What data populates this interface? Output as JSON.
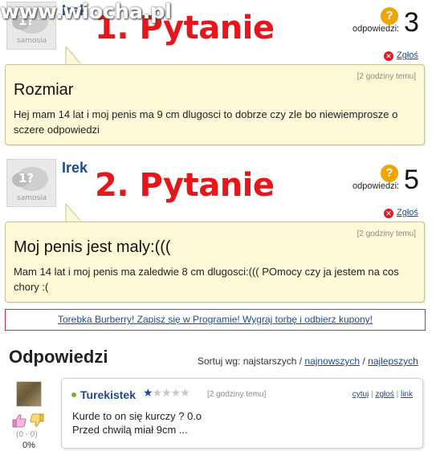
{
  "watermark": "www.wiocha.pl",
  "questions": [
    {
      "username": "Irek",
      "big_label": "1. Pytanie",
      "avatar_brand": "samosia",
      "answers_label": "odpowiedzi:",
      "answers_count": "3",
      "report_label": "Zgłoś",
      "time": "[2 godziny temu]",
      "title": "Rozmiar",
      "text": "Hej mam 14 lat i moj penis ma 9 cm dlugosci to dobrze czy zle bo niewiemprosze o sczere odpowiedzi"
    },
    {
      "username": "Irek",
      "big_label": "2. Pytanie",
      "avatar_brand": "samosia",
      "answers_label": "odpowiedzi:",
      "answers_count": "5",
      "report_label": "Zgłoś",
      "time": "[2 godziny temu]",
      "title": "Moj penis jest maly:(((",
      "text": "Mam 14 lat i moj penis ma zaledwie 8 cm dlugosci:((( POmocy czy ja jestem na cos chory :("
    }
  ],
  "promo": "Torebka Burberry! Zapisz się w Programie! Wygraj torbę i odbierz kupony!",
  "answers_section": {
    "title": "Odpowiedzi",
    "sort_label": "Sortuj wg: najstarszych /",
    "sort_newest": "najnowszych",
    "sort_sep": "/",
    "sort_best": "najlepszych"
  },
  "answer": {
    "username": "Turekistek",
    "time": "[2 godziny temu]",
    "action_quote": "cytuj",
    "action_report": "zgłoś",
    "action_link": "link",
    "sep": "|",
    "line1": "Kurde to on się kurczy ? 0.o",
    "line2": "Przed chwilą miał 9cm ...",
    "votes": "(0 - 0)",
    "percent": "0%",
    "rank_stars": 1,
    "rank_total": 5
  },
  "colors": {
    "link": "#1e4a8e",
    "red_label": "#e8161b",
    "question_box": "#fdf8d6",
    "help_icon": "#f1a400",
    "promo_border": "#d13232"
  }
}
